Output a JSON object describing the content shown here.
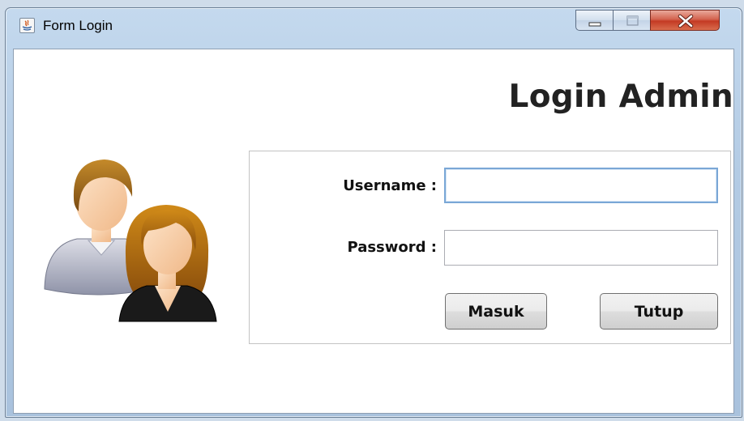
{
  "window": {
    "title": "Form Login",
    "icon": "java-app-icon",
    "controls": [
      "minimize-icon",
      "maximize-icon",
      "close-icon"
    ]
  },
  "main": {
    "heading": "Login Admin",
    "illustration": "users-icon"
  },
  "form": {
    "username_label": "Username :",
    "username_value": "",
    "password_label": "Password :",
    "password_value": "",
    "submit_label": "Masuk",
    "close_label": "Tutup"
  },
  "colors": {
    "titlebar": "#b3cbe4",
    "close_button": "#c43a24",
    "focus_border": "#7aa7d6",
    "background": "#ffffff"
  }
}
